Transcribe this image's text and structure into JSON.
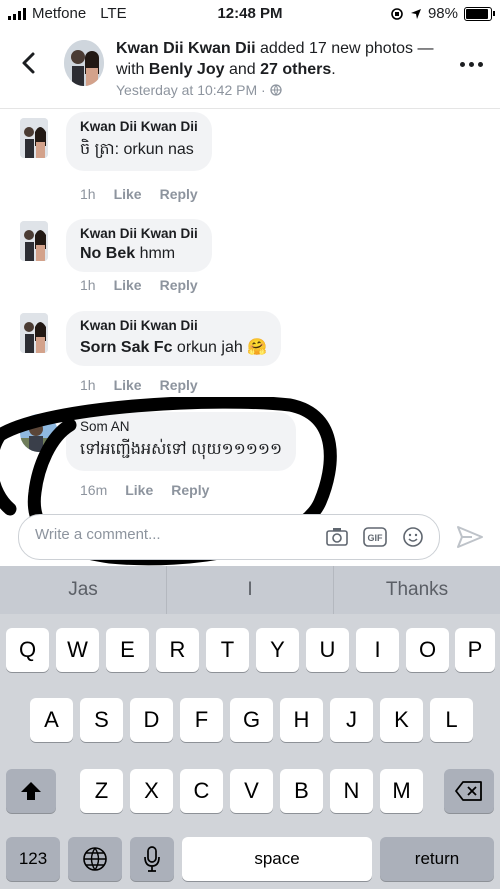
{
  "status_bar": {
    "carrier": "Metfone",
    "network": "LTE",
    "time": "12:48 PM",
    "battery": "98%",
    "battery_level": 0.98
  },
  "header": {
    "author": "Kwan Dii Kwan Dii",
    "action": "added 17 new photos — with",
    "tagged": "Benly Joy",
    "and": "and",
    "others": "27 others",
    "suffix": ".",
    "timestamp": "Yesterday at 10:42 PM ·",
    "privacy_icon": "globe-icon"
  },
  "comments": [
    {
      "name": "Kwan Dii Kwan Dii",
      "bold": "",
      "text": "ចិ ត្រា: orkun nas",
      "time": "1h",
      "like": "Like",
      "reply": "Reply"
    },
    {
      "name": "Kwan Dii Kwan Dii",
      "bold": "No Bek",
      "text": " hmm",
      "time": "1h",
      "like": "Like",
      "reply": "Reply"
    },
    {
      "name": "Kwan Dii Kwan Dii",
      "bold": "Sorn Sak Fc",
      "text": " orkun  jah 🤗",
      "time": "1h",
      "like": "Like",
      "reply": "Reply"
    },
    {
      "name": "Som AN",
      "bold": "",
      "text": "ទៅអញ្ជើងអស់ទៅ លុយ១១១១១",
      "time": "16m",
      "like": "Like",
      "reply": "Reply"
    }
  ],
  "composer": {
    "placeholder": "Write a comment...",
    "icons": [
      "camera-icon",
      "gif-icon",
      "sticker-icon",
      "send-icon"
    ]
  },
  "keyboard": {
    "suggestions": [
      "Jas",
      "I",
      "Thanks"
    ],
    "row1": [
      "Q",
      "W",
      "E",
      "R",
      "T",
      "Y",
      "U",
      "I",
      "O",
      "P"
    ],
    "row2": [
      "A",
      "S",
      "D",
      "F",
      "G",
      "H",
      "J",
      "K",
      "L"
    ],
    "row3": [
      "Z",
      "X",
      "C",
      "V",
      "B",
      "N",
      "M"
    ],
    "numbers": "123",
    "space": "space",
    "return": "return"
  }
}
